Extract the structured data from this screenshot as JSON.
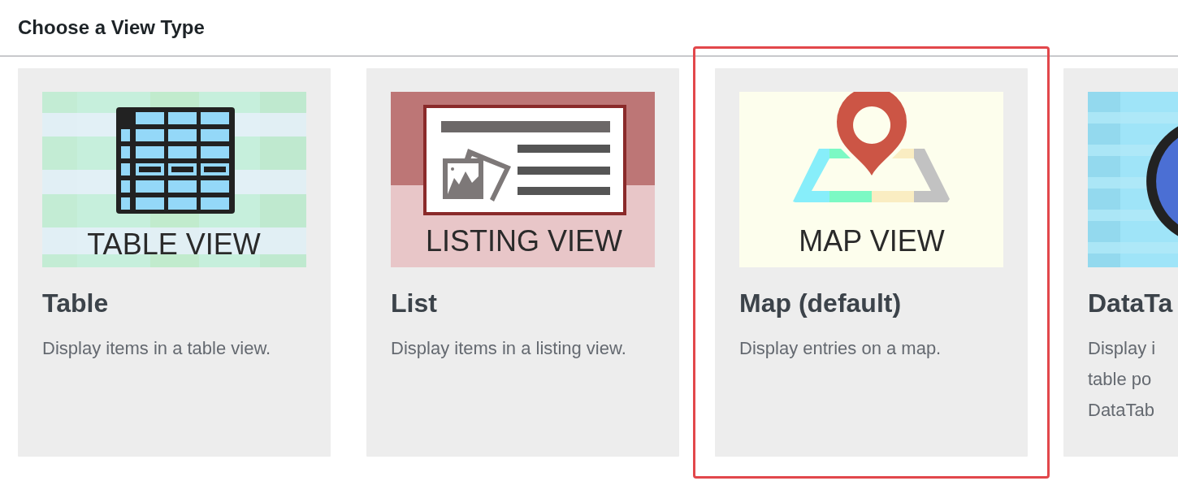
{
  "header": {
    "title": "Choose a View Type"
  },
  "cards": [
    {
      "title": "Table",
      "description": "Display items in a table view.",
      "selected": false,
      "image": {
        "kind": "table",
        "label": "TABLE VIEW"
      }
    },
    {
      "title": "List",
      "description": "Display items in a listing view.",
      "selected": false,
      "image": {
        "kind": "listing",
        "label": "LISTING VIEW"
      }
    },
    {
      "title": "Map (default)",
      "description": "Display entries on a map.",
      "selected": true,
      "image": {
        "kind": "map",
        "label": "MAP VIEW"
      }
    },
    {
      "title": "DataTa",
      "description": "Display i\ntable po\nDataTab",
      "selected": false,
      "image": {
        "kind": "datatable"
      }
    }
  ]
}
